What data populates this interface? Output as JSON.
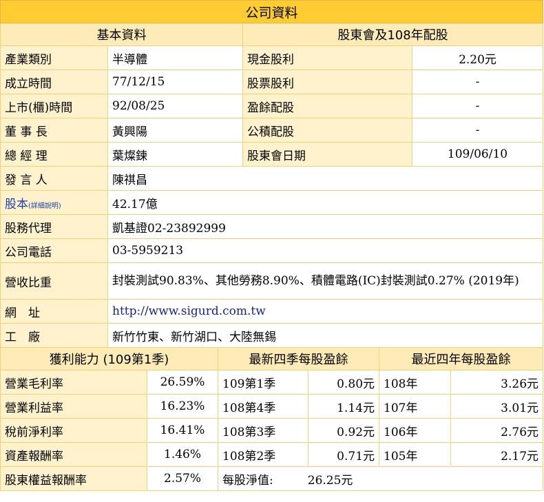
{
  "title": "公司資料",
  "basic": {
    "header": "基本資料",
    "rows": [
      {
        "label": "產業類別",
        "value": "半導體"
      },
      {
        "label": "成立時間",
        "value": "77/12/15"
      },
      {
        "label": "上市(櫃)時間",
        "value": "92/08/25"
      },
      {
        "label": "董 事 長",
        "value": "黃興陽"
      },
      {
        "label": "總 經 理",
        "value": "葉燦鍊"
      }
    ]
  },
  "dividend": {
    "header": "股東會及108年配股",
    "rows": [
      {
        "label": "現金股利",
        "value": "2.20元"
      },
      {
        "label": "股票股利",
        "value": "-"
      },
      {
        "label": "盈餘配股",
        "value": "-"
      },
      {
        "label": "公積配股",
        "value": "-"
      },
      {
        "label": "股東會日期",
        "value": "109/06/10"
      }
    ]
  },
  "info": {
    "spokesperson_label": "發 言 人",
    "spokesperson": "陳祺昌",
    "capital_label": "股本",
    "capital_note": "(詳細說明)",
    "capital": "42.17億",
    "agent_label": "股務代理",
    "agent": "凱基證02-23892999",
    "phone_label": "公司電話",
    "phone": "03-5959213",
    "revenue_label": "營收比重",
    "revenue": "封裝測試90.83%、其他勞務8.90%、積體電路(IC)封裝測試0.27% (2019年)",
    "website_label": "網　址",
    "website": "http://www.sigurd.com.tw",
    "factory_label": "工　廠",
    "factory": "新竹竹東、新竹湖口、大陸無錫"
  },
  "profit": {
    "header": "獲利能力 (109第1季)",
    "rows": [
      {
        "label": "營業毛利率",
        "value": "26.59%"
      },
      {
        "label": "營業利益率",
        "value": "16.23%"
      },
      {
        "label": "稅前淨利率",
        "value": "16.41%"
      },
      {
        "label": "資產報酬率",
        "value": "1.46%"
      },
      {
        "label": "股東權益報酬率",
        "value": "2.57%"
      }
    ]
  },
  "quarterly_eps": {
    "header": "最新四季每股盈餘",
    "rows": [
      {
        "period": "109第1季",
        "value": "0.80元"
      },
      {
        "period": "108第4季",
        "value": "1.14元"
      },
      {
        "period": "108第3季",
        "value": "0.92元"
      },
      {
        "period": "108第2季",
        "value": "0.71元"
      }
    ],
    "nav_label": "每股淨值:",
    "nav_value": "26.25元"
  },
  "annual_eps": {
    "header": "最近四年每股盈餘",
    "rows": [
      {
        "year": "108年",
        "value": "3.26元"
      },
      {
        "year": "107年",
        "value": "3.01元"
      },
      {
        "year": "106年",
        "value": "2.76元"
      },
      {
        "year": "105年",
        "value": "2.17元"
      }
    ]
  }
}
